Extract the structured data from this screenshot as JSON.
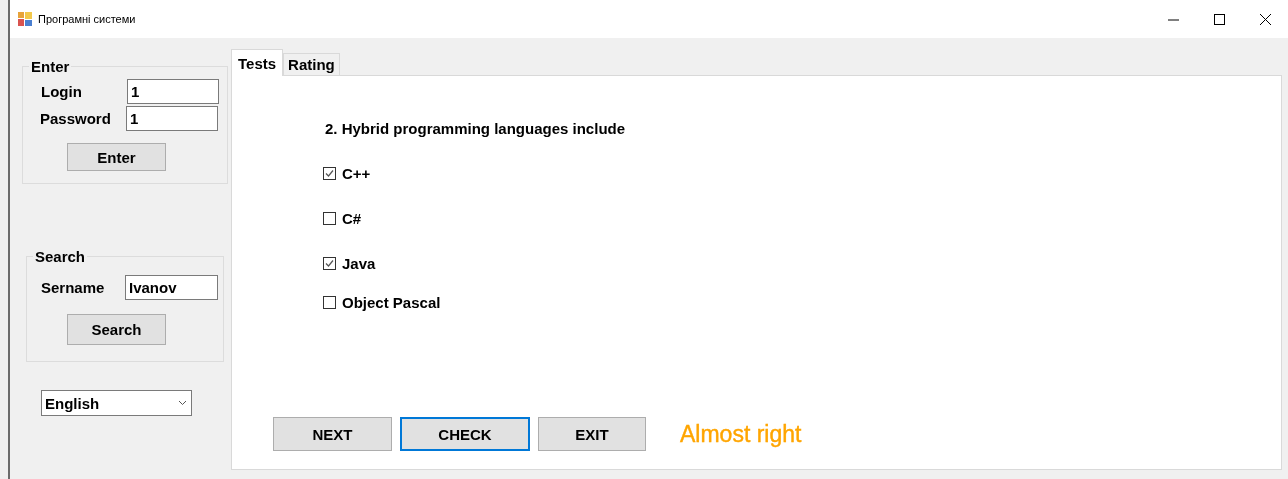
{
  "window": {
    "title": "Програмні системи"
  },
  "login_group": {
    "title": "Enter",
    "login_label": "Login",
    "login_value": "1",
    "password_label": "Password",
    "password_value": "1",
    "button": "Enter"
  },
  "search_group": {
    "title": "Search",
    "surname_label": "Sername",
    "surname_value": "Ivanov",
    "button": "Search"
  },
  "language": {
    "value": "English"
  },
  "tabs": [
    {
      "label": "Tests",
      "selected": true
    },
    {
      "label": "Rating",
      "selected": false
    }
  ],
  "question": "2. Hybrid programming languages include",
  "options": [
    {
      "label": "C++",
      "checked": true
    },
    {
      "label": "C#",
      "checked": false
    },
    {
      "label": "Java",
      "checked": true
    },
    {
      "label": "Object Pascal",
      "checked": false
    }
  ],
  "buttons": [
    {
      "label": "NEXT",
      "focused": false
    },
    {
      "label": "CHECK",
      "focused": true
    },
    {
      "label": "EXIT",
      "focused": false
    }
  ],
  "message": "Almost right"
}
